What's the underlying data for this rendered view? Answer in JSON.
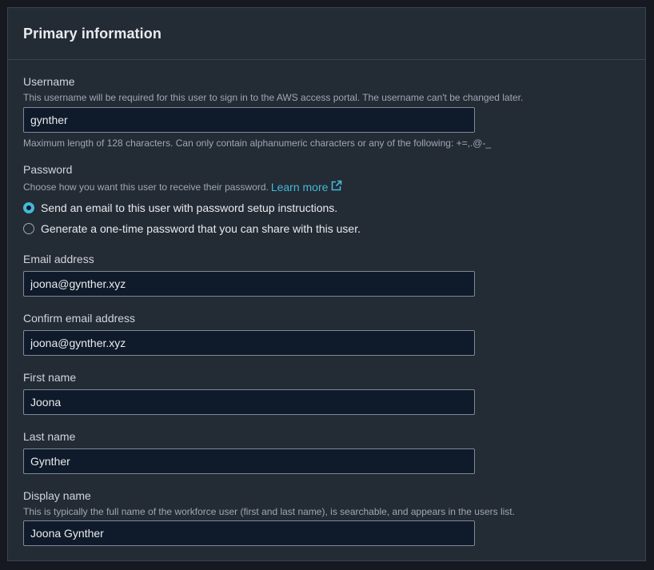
{
  "section": {
    "title": "Primary information"
  },
  "username": {
    "label": "Username",
    "description": "This username will be required for this user to sign in to the AWS access portal. The username can't be changed later.",
    "value": "gynther",
    "constraint": "Maximum length of 128 characters. Can only contain alphanumeric characters or any of the following: +=,.@-_"
  },
  "password": {
    "label": "Password",
    "description": "Choose how you want this user to receive their password.",
    "learn_more": "Learn more",
    "options": [
      {
        "label": "Send an email to this user with password setup instructions.",
        "selected": true
      },
      {
        "label": "Generate a one-time password that you can share with this user.",
        "selected": false
      }
    ]
  },
  "email": {
    "label": "Email address",
    "value": "joona@gynther.xyz"
  },
  "confirm_email": {
    "label": "Confirm email address",
    "value": "joona@gynther.xyz"
  },
  "first_name": {
    "label": "First name",
    "value": "Joona"
  },
  "last_name": {
    "label": "Last name",
    "value": "Gynther"
  },
  "display_name": {
    "label": "Display name",
    "description": "This is typically the full name of the workforce user (first and last name), is searchable, and appears in the users list.",
    "value": "Joona Gynther"
  },
  "colors": {
    "accent": "#44b9d6",
    "panel_bg": "#232b35",
    "input_bg": "#0f1b2a"
  }
}
